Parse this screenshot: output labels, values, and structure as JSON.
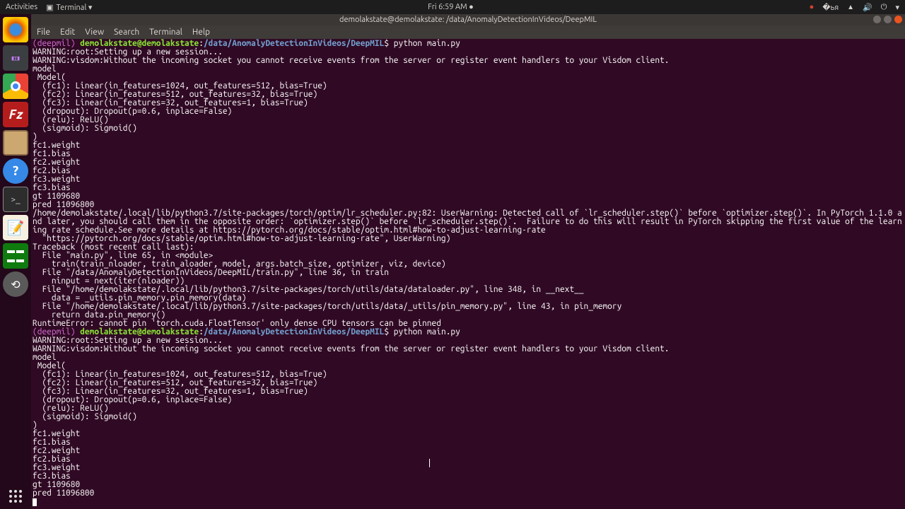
{
  "topbar": {
    "activities": "Activities",
    "app": "Terminal ▾",
    "clock": "Fri  6:59 AM ●"
  },
  "dock": {
    "firefox_bg": "#cd5b1b",
    "chrome_bg": "#ffffff",
    "filezilla_bg": "#b51d1d",
    "files_bg": "#8b6b47",
    "help_bg": "#3689e6",
    "terminal_bg": "#2d2d2d",
    "gedit_bg": "#edd780",
    "calc_bg": "#0f7b0f",
    "updater_bg": "#5a5a5a"
  },
  "window": {
    "title": "demolakstate@demolakstate: /data/AnomalyDetectionInVideos/DeepMIL",
    "menu": [
      "File",
      "Edit",
      "View",
      "Search",
      "Terminal",
      "Help"
    ],
    "controls": {
      "min": "#6f6a67",
      "max": "#6f6a67",
      "close": "#e95420"
    }
  },
  "prompt": {
    "env": "(deepmil) ",
    "user": "demolakstate@demolakstate",
    "colon": ":",
    "path": "/data/AnomalyDetectionInVideos/DeepMIL",
    "dollar": "$ ",
    "cmd": "python main.py"
  },
  "out": {
    "warn1": "WARNING:root:Setting up a new session...",
    "warn2": "WARNING:visdom:Without the incoming socket you cannot receive events from the server or register event handlers to your Visdom client.",
    "model_hdr": "model",
    "model1": " Model(",
    "model2": "  (fc1): Linear(in_features=1024, out_features=512, bias=True)",
    "model3": "  (fc2): Linear(in_features=512, out_features=32, bias=True)",
    "model4": "  (fc3): Linear(in_features=32, out_features=1, bias=True)",
    "model5": "  (dropout): Dropout(p=0.6, inplace=False)",
    "model6": "  (relu): ReLU()",
    "model7": "  (sigmoid): Sigmoid()",
    "model8": ")",
    "p1": "fc1.weight",
    "p2": "fc1.bias",
    "p3": "fc2.weight",
    "p4": "fc2.bias",
    "p5": "fc3.weight",
    "p6": "fc3.bias",
    "gt": "gt 1109680",
    "pred": "pred 11096800",
    "uw1": "/home/demolakstate/.local/lib/python3.7/site-packages/torch/optim/lr_scheduler.py:82: UserWarning: Detected call of `lr_scheduler.step()` before `optimizer.step()`. In PyTorch 1.1.0 and later, you should call them in the opposite order: `optimizer.step()` before `lr_scheduler.step()`.  Failure to do this will result in PyTorch skipping the first value of the learning rate schedule.See more details at https://pytorch.org/docs/stable/optim.html#how-to-adjust-learning-rate",
    "uw2": "  \"https://pytorch.org/docs/stable/optim.html#how-to-adjust-learning-rate\", UserWarning)",
    "tb0": "Traceback (most recent call last):",
    "tb1": "  File \"main.py\", line 65, in <module>",
    "tb2": "    train(train_nloader, train_aloader, model, args.batch_size, optimizer, viz, device)",
    "tb3": "  File \"/data/AnomalyDetectionInVideos/DeepMIL/train.py\", line 36, in train",
    "tb4": "    ninput = next(iter(nloader))",
    "tb5": "  File \"/home/demolakstate/.local/lib/python3.7/site-packages/torch/utils/data/dataloader.py\", line 348, in __next__",
    "tb6": "    data = _utils.pin_memory.pin_memory(data)",
    "tb7": "  File \"/home/demolakstate/.local/lib/python3.7/site-packages/torch/utils/data/_utils/pin_memory.py\", line 43, in pin_memory",
    "tb8": "    return data.pin_memory()",
    "err": "RuntimeError: cannot pin 'torch.cuda.FloatTensor' only dense CPU tensors can be pinned"
  }
}
